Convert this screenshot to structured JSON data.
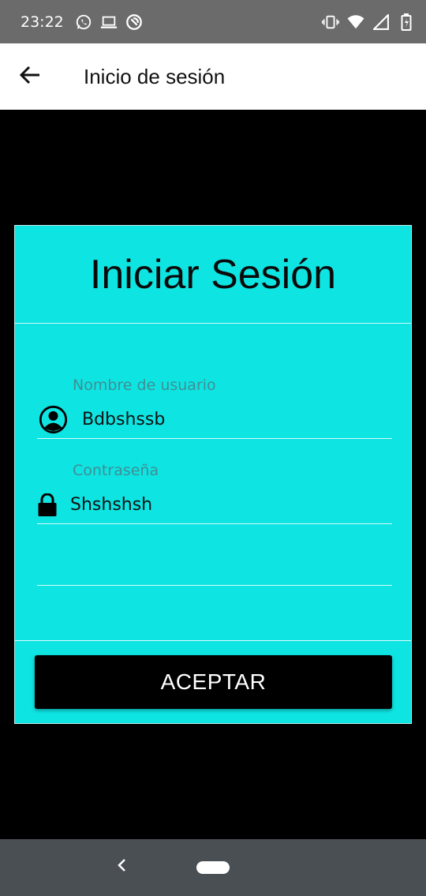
{
  "status_bar": {
    "time": "23:22",
    "left_icons": [
      "whatsapp-icon",
      "laptop-icon",
      "sync-icon"
    ],
    "right_icons": [
      "vibrate-icon",
      "wifi-icon",
      "signal-icon",
      "battery-charging-icon"
    ]
  },
  "app_bar": {
    "back_icon": "arrow-left-icon",
    "title": "Inicio de sesión"
  },
  "login_card": {
    "heading": "Iniciar Sesión",
    "username": {
      "label": "Nombre de usuario",
      "value": "Bdbshssb",
      "icon": "account-circle-icon"
    },
    "password": {
      "label": "Contraseña",
      "value": "Shshshsh",
      "icon": "lock-icon"
    },
    "submit_label": "ACEPTAR"
  },
  "colors": {
    "card_background": "#0ee4e2",
    "status_bar": "#6b6b6b",
    "nav_bar": "#4a4f54",
    "label_text": "#3f8f95"
  },
  "nav_bar": {
    "back_icon": "nav-back-icon",
    "home_icon": "home-pill-icon"
  }
}
